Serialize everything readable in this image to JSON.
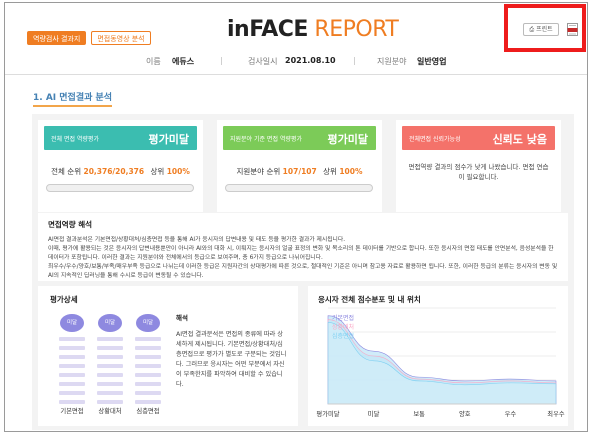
{
  "header": {
    "tabs": [
      "역량검사 결과지",
      "면접동영상 분석"
    ],
    "brand_bold": "inFACE",
    "brand_light": "REPORT",
    "print_label": "프린트",
    "colors": {
      "accent": "#ef7d22",
      "highlight_box": "#ee1c1c"
    }
  },
  "info": {
    "name_label": "이름",
    "name": "에듀스",
    "date_label": "검사일시",
    "date": "2021.08.10",
    "field_label": "지원분야",
    "field": "일반영업"
  },
  "section_title": "1. AI 면접결과 분석",
  "cards": [
    {
      "label": "전체 면접 역량평가",
      "value": "평가미달",
      "rank_label": "전체 순위",
      "rank": "20,376/20,376",
      "top_label": "상위",
      "top": "100%",
      "color": "#3bbdb0"
    },
    {
      "label": "지원분야 기준 면접 역량평가",
      "value": "평가미달",
      "rank_label": "지원분야 순위",
      "rank": "107/107",
      "top_label": "상위",
      "top": "100%",
      "color": "#7ccb58"
    },
    {
      "label": "전체면접 신뢰가능성",
      "value": "신뢰도 낮음",
      "text": "면접역량 결과의 점수가 낮게 나왔습니다. 면접 연습이 필요합니다.",
      "color": "#f4726a"
    }
  ],
  "analysis": {
    "title": "면접역량 해석",
    "lines": [
      "AI면접 결과분석은 기본면접/상황대처/심층면접 등을 통해 AI가 응시자의 답변내용 및 태도 등을 평가한 결과가 제시됩니다.",
      "이때, 평가에 활용되는 것은 응시자의 답변내용뿐만이 아니라 AI와의 대화 시, 이뤄지는 응시자의 얼굴 표정의 변화 및 목소리의 톤 데이터를 기반으로 합니다. 또한 응시자의 면접 태도를 안면분석, 음성분석을 한 데이터가 포함됩니다. 이러한 결과는 지원분야와 전체에서의 등급으로 보여주며, 총 6가지 등급으로 나뉘어집니다.",
      "최우수/우수/양호/보통/부족/매우부족 등급으로 나뉘는데 이러한 등급은 지원자간의 상대평가에 따른 것으로, 절대적인 기준은 아니며 참고용 자료로 활용하면 됩니다. 또한, 이러한 등급의 분류는 응시자의 변동 및 AI의 지속적인 딥러닝을 통해 수시로 등급이 변동될 수 있습니다."
    ]
  },
  "detail": {
    "title": "평가상세",
    "badge": "미달",
    "columns": [
      "기본면접",
      "상황대처",
      "심층면접"
    ],
    "subtitle": "해석",
    "text": "AI면접 결과분석은 면접의 종류에 따라 상세하게 제시됩니다. 기본면접/상황대처/심층면접으로 평가가 별도로 구분되는 것입니다. 그러므로 응시자는 어떤 부분에서 자신이 부족한지를 파악하여 대비할 수 있습니다."
  },
  "distribution": {
    "title": "응시자 전체 점수분포 및 내 위치"
  },
  "chart_data": {
    "type": "area",
    "title": "응시자 전체 점수분포 및 내 위치",
    "categories": [
      "평가미달",
      "미달",
      "보통",
      "양호",
      "우수",
      "최우수"
    ],
    "legend": [
      "기본면접",
      "상황대처",
      "심층면접"
    ],
    "legend_colors": [
      "#8e89e0",
      "#f9a7c5",
      "#7fd0f2"
    ],
    "series": [
      {
        "name": "기본면접",
        "values": [
          0.92,
          0.55,
          0.28,
          0.24,
          0.26,
          0.24
        ]
      },
      {
        "name": "상황대처",
        "values": [
          0.88,
          0.5,
          0.26,
          0.22,
          0.24,
          0.22
        ]
      },
      {
        "name": "심층면접",
        "values": [
          0.85,
          0.45,
          0.24,
          0.2,
          0.22,
          0.21
        ]
      }
    ],
    "fill_color": "#a9dcf4",
    "grid": true,
    "legend_position": "top-left"
  }
}
